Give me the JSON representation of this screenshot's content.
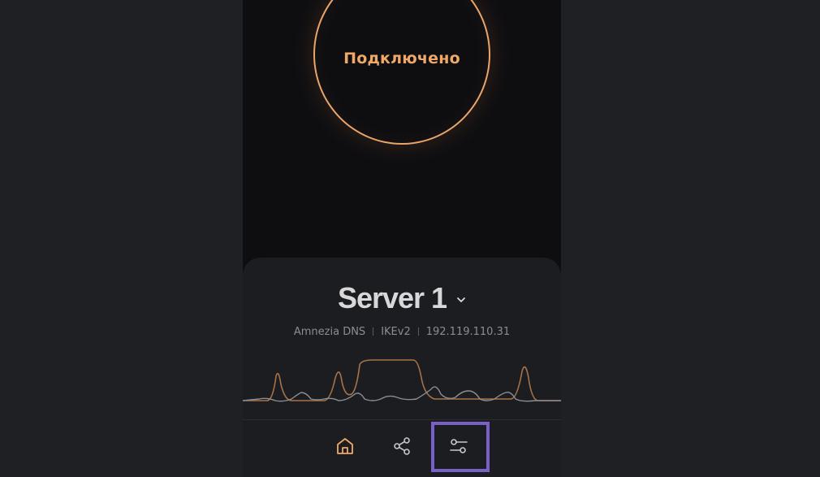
{
  "status": {
    "label": "Подключено"
  },
  "server": {
    "name": "Server 1",
    "dns": "Amnezia DNS",
    "protocol": "IKEv2",
    "ip": "192.119.110.31"
  },
  "colors": {
    "accent": "#f0a868",
    "ring": "#e9a56a",
    "highlight": "#7b61c7",
    "background": "#1f2024",
    "screen": "#0e0e11"
  },
  "nav": {
    "items": [
      {
        "icon": "home-icon",
        "active": true
      },
      {
        "icon": "share-icon",
        "active": false
      },
      {
        "icon": "settings-sliders-icon",
        "active": false,
        "highlighted": true
      }
    ]
  },
  "traffic_graph": {
    "series": [
      {
        "color": "#a87346"
      },
      {
        "color": "#8c8c92"
      }
    ]
  }
}
